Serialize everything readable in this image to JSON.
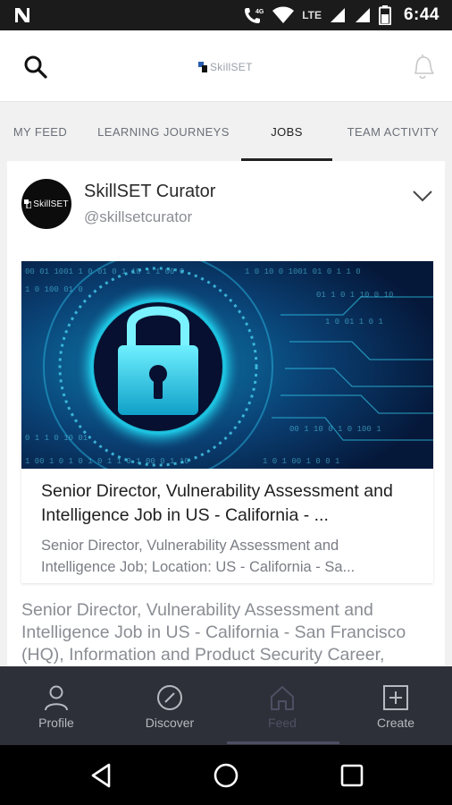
{
  "status_bar": {
    "time": "6:44",
    "network": "LTE",
    "signal": "4G",
    "icons": [
      "n-logo-icon",
      "wifi-call-icon",
      "wifi-icon",
      "lte-signal-icon",
      "cell-signal-icon",
      "battery-icon"
    ]
  },
  "header": {
    "logo_text": "SkillSET",
    "icons": [
      "search-icon",
      "bell-icon"
    ]
  },
  "tabs": [
    {
      "label": "MY FEED",
      "active": false
    },
    {
      "label": "LEARNING JOURNEYS",
      "active": false
    },
    {
      "label": "JOBS",
      "active": true
    },
    {
      "label": "TEAM ACTIVITY",
      "active": false
    }
  ],
  "post": {
    "author_name": "SkillSET Curator",
    "author_handle": "@skillsetcurator",
    "avatar_text": "SkillSET",
    "link_title": "Senior Director, Vulnerability Assessment and Intelligence Job in US - California - ...",
    "link_description": "Senior Director, Vulnerability Assessment and Intelligence Job; Location: US - California - Sa...",
    "body_text": "Senior Director, Vulnerability Assessment and Intelligence Job in US - California - San Francisco (HQ), Information and Product Security Career,"
  },
  "bottom_nav": [
    {
      "label": "Profile",
      "icon": "profile-icon",
      "active": false
    },
    {
      "label": "Discover",
      "icon": "compass-icon",
      "active": false
    },
    {
      "label": "Feed",
      "icon": "home-icon",
      "active": true
    },
    {
      "label": "Create",
      "icon": "plus-square-icon",
      "active": false
    }
  ],
  "colors": {
    "tab_bg": "#f1f1f1",
    "nav_bg": "#2e3039",
    "nav_active": "#4d5063",
    "hero_accent": "#1ec8e6"
  }
}
